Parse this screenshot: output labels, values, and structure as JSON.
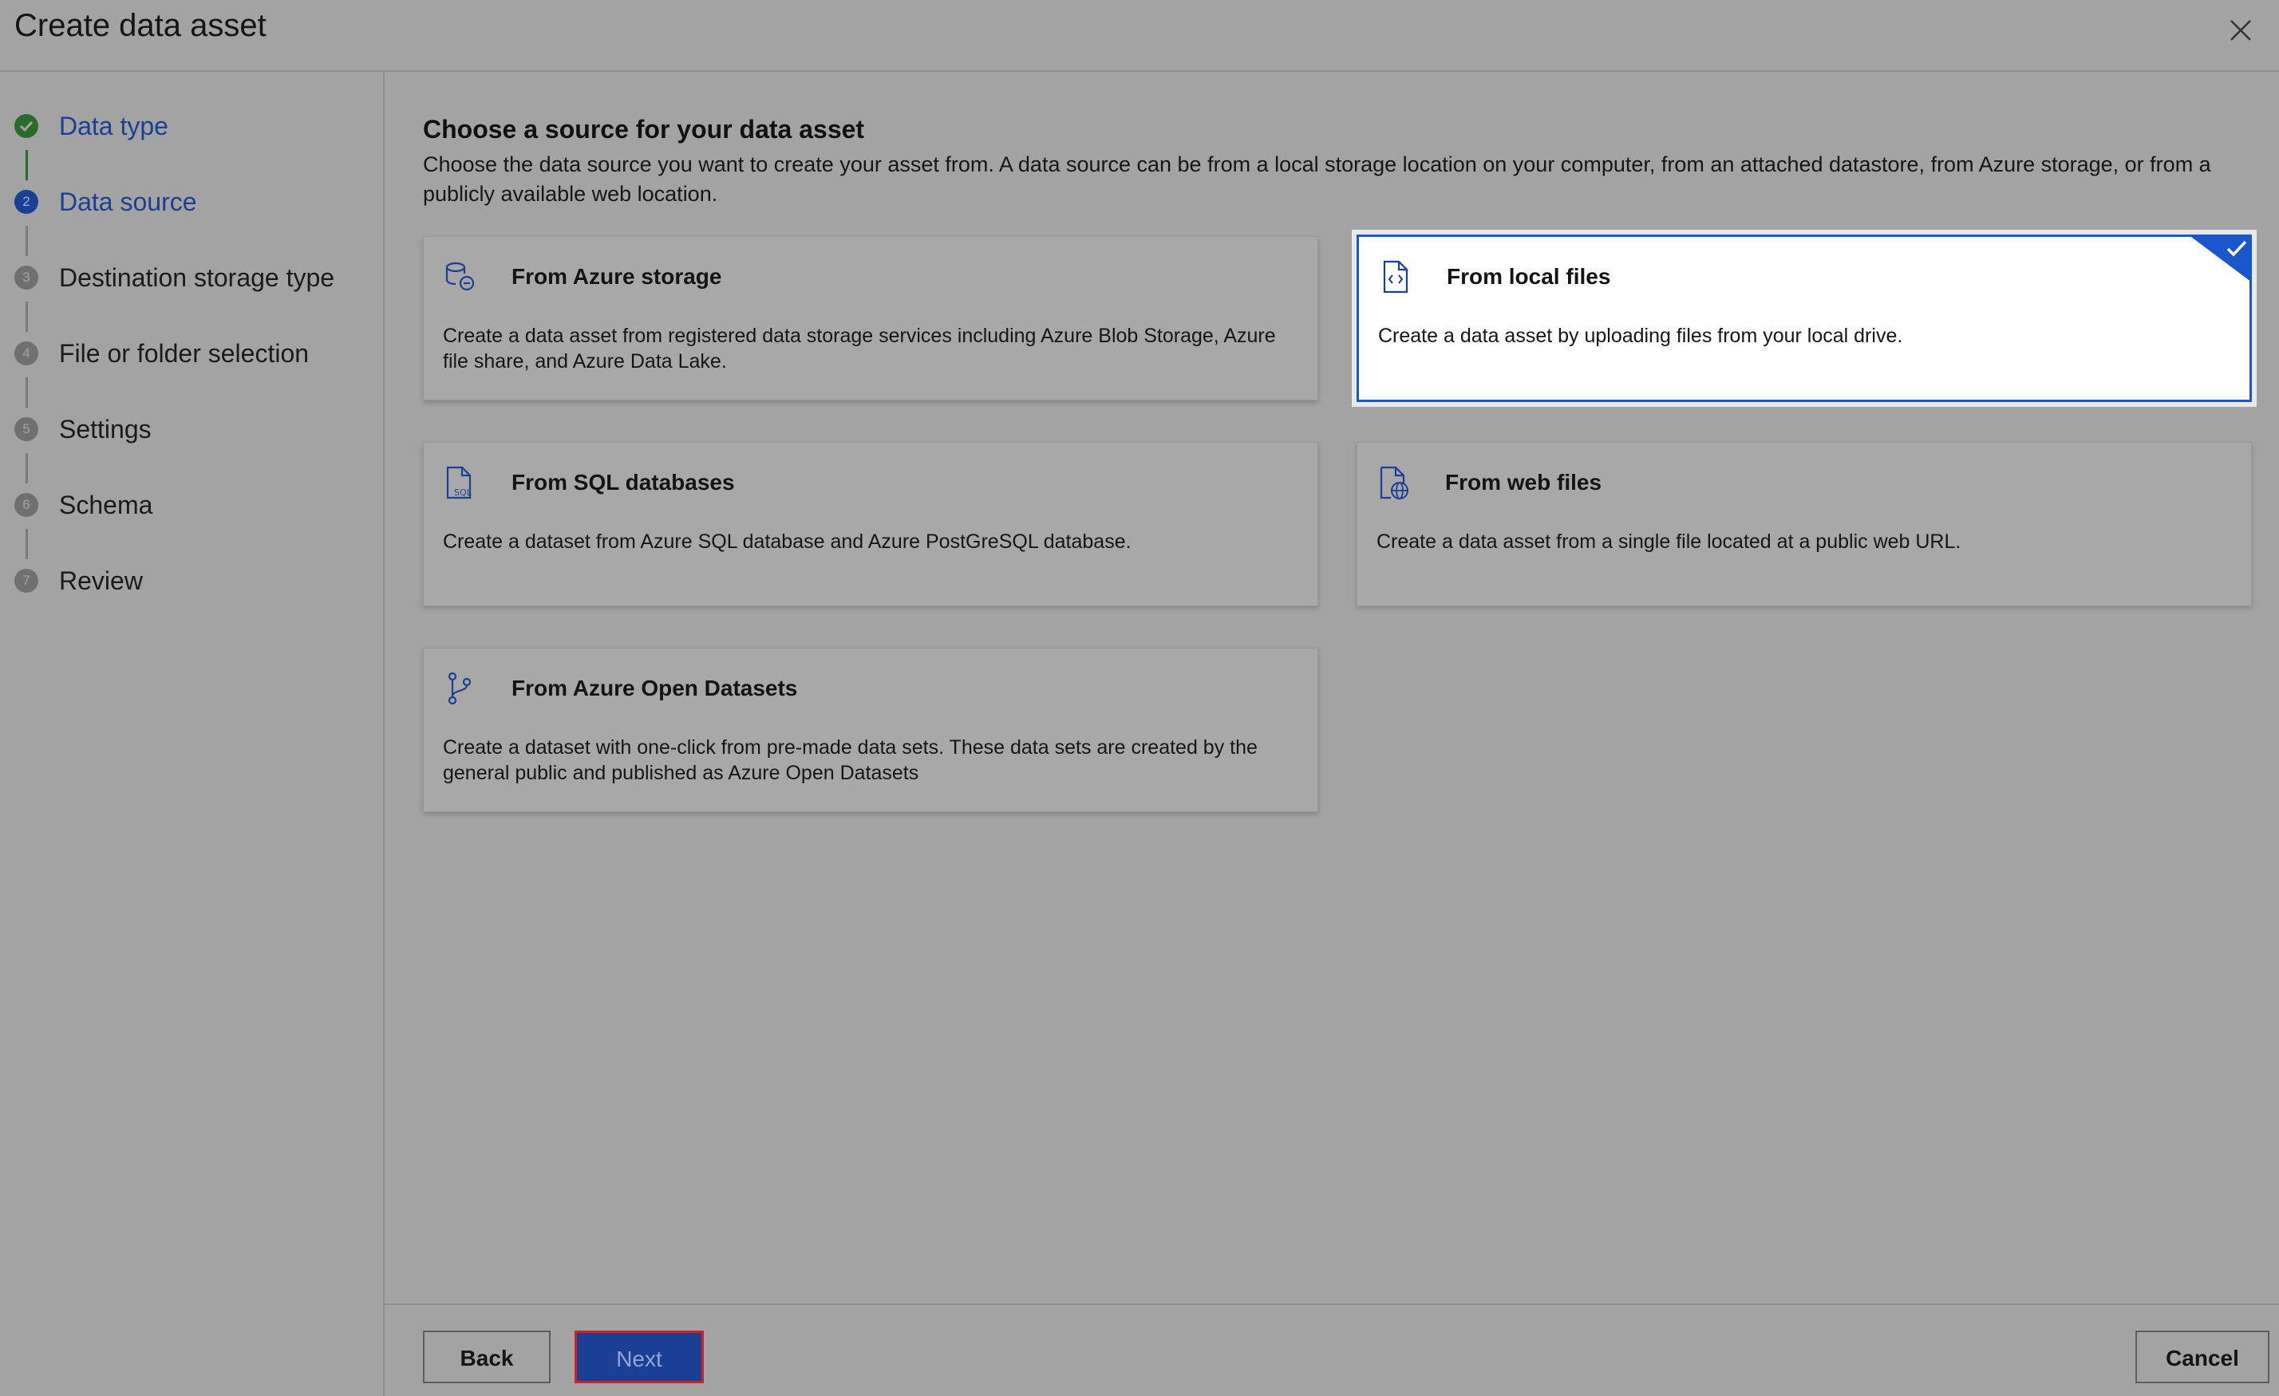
{
  "dialog": {
    "title": "Create data asset"
  },
  "steps": [
    {
      "number": "1",
      "label": "Data type",
      "state": "done"
    },
    {
      "number": "2",
      "label": "Data source",
      "state": "current"
    },
    {
      "number": "3",
      "label": "Destination storage type",
      "state": "todo"
    },
    {
      "number": "4",
      "label": "File or folder selection",
      "state": "todo"
    },
    {
      "number": "5",
      "label": "Settings",
      "state": "todo"
    },
    {
      "number": "6",
      "label": "Schema",
      "state": "todo"
    },
    {
      "number": "7",
      "label": "Review",
      "state": "todo"
    }
  ],
  "main": {
    "heading": "Choose a source for your data asset",
    "description": "Choose the data source you want to create your asset from. A data source can be from a local storage location on your computer, from an attached datastore, from Azure storage, or from a publicly available web location.",
    "cards": [
      {
        "id": "azure-storage",
        "title": "From Azure storage",
        "desc": "Create a data asset from registered data storage services including Azure Blob Storage, Azure file share, and Azure Data Lake.",
        "icon": "storage-icon",
        "selected": false
      },
      {
        "id": "local-files",
        "title": "From local files",
        "desc": "Create a data asset by uploading files from your local drive.",
        "icon": "file-code-icon",
        "selected": true
      },
      {
        "id": "sql-databases",
        "title": "From SQL databases",
        "desc": "Create a dataset from Azure SQL database and Azure PostGreSQL database.",
        "icon": "sql-file-icon",
        "selected": false
      },
      {
        "id": "web-files",
        "title": "From web files",
        "desc": "Create a data asset from a single file located at a public web URL.",
        "icon": "web-file-icon",
        "selected": false
      },
      {
        "id": "open-datasets",
        "title": "From Azure Open Datasets",
        "desc": "Create a dataset with one-click from pre-made data sets. These data sets are created by the general public and published as Azure Open Datasets",
        "icon": "branch-icon",
        "selected": false
      }
    ]
  },
  "footer": {
    "back": "Back",
    "next": "Next",
    "cancel": "Cancel"
  },
  "colors": {
    "accent": "#1a3f94",
    "selected_border": "#1a56cc",
    "done": "#2a6b2a",
    "highlight": "#d02020"
  }
}
